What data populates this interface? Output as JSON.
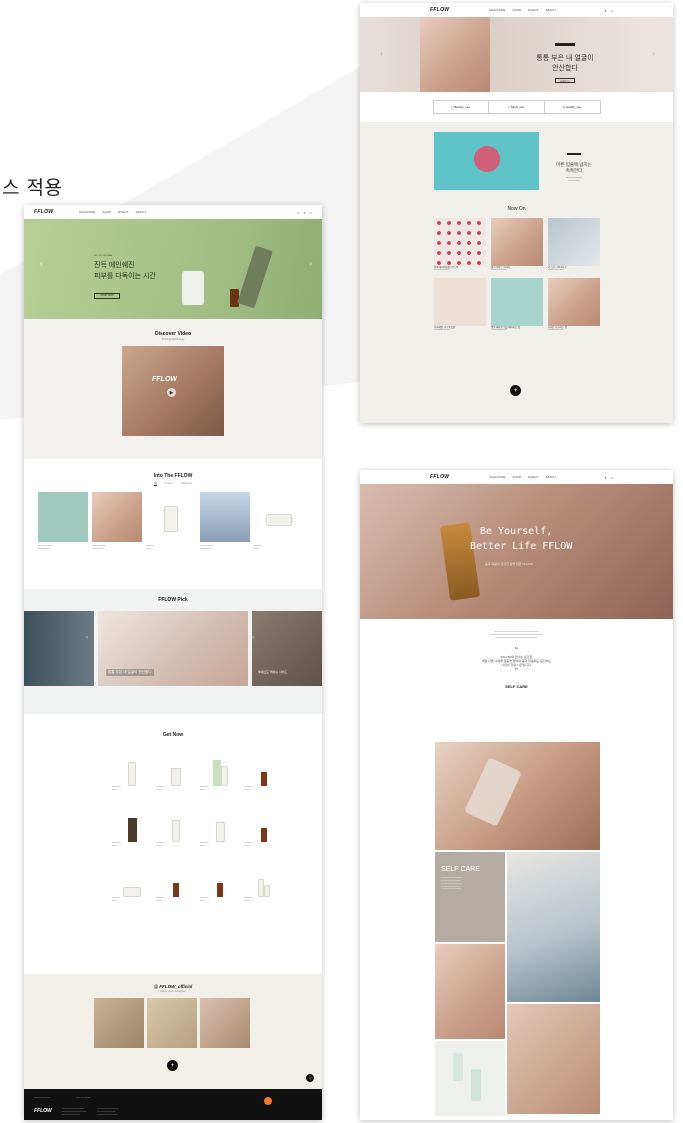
{
  "caption": "스 적용",
  "colors": {
    "hero_green": "#a9c48a",
    "beige": "#f1efe9",
    "footer": "#111111"
  },
  "nav": {
    "logo": "FFLOW",
    "items": [
      "MAGAZINE",
      "SHOP",
      "EVENT",
      "ABOUT"
    ]
  },
  "left": {
    "hero_title_1": "진득 에인쉐진",
    "hero_title_2": "피부를 다독이는 시간",
    "hero_button": "SHOP NOW",
    "video_title": "Discover Video",
    "video_sub": "Refining Self Beauty",
    "video_logo": "FFLOW",
    "into_title": "Into The FFLOW",
    "into_tabs": [
      "All",
      "Product",
      "Magazine"
    ],
    "pick_title": "FFLOW Pick",
    "pick_caption": "통통 부은 내 얼굴이 안산합다",
    "pick_caption_right": "부쉐으도 케이는 사이드",
    "getnow_title": "Get Now",
    "insta_title": "@ FFLOW_official",
    "insta_sub": "Follow us on Instagram",
    "footer_logo": "FFLOW"
  },
  "topright": {
    "hero_title_1": "통통 부은 내 얼굴이",
    "hero_title_2": "안산합다",
    "hero_button": "자세히보기",
    "tabs": [
      "Beauty_seo",
      "Mind_you",
      "Health_you"
    ],
    "feature_title_1": "마른 입술에 넘치는",
    "feature_title_2": "촉촉한다",
    "now_on": "Now On",
    "cards": [
      "반짝 에이치빙빙, 입스색",
      "결기 디탁스 마사지",
      "가스만 ~ 24-7만힘",
      "다하에면 코더 통질품",
      "평량 해나운 염을 헤아리는 법",
      "라레즈 다소마는 법"
    ]
  },
  "bottomright": {
    "hero_line1": "Be Yourself,",
    "hero_line2": "Better Life FFLOW",
    "hero_sub": "몸과 마음이 건강한 삶을 위한 FFLOW",
    "quote_1": "FFLOW와 만나는 순간은",
    "quote_2": "매일 다른 나에게 집중을 들이며 몸과 마음에도 충전하는",
    "quote_3": "나만의 힐링 시간입니다.",
    "self_care": "SELF CARE",
    "self_care_block": "SELF CARE"
  }
}
